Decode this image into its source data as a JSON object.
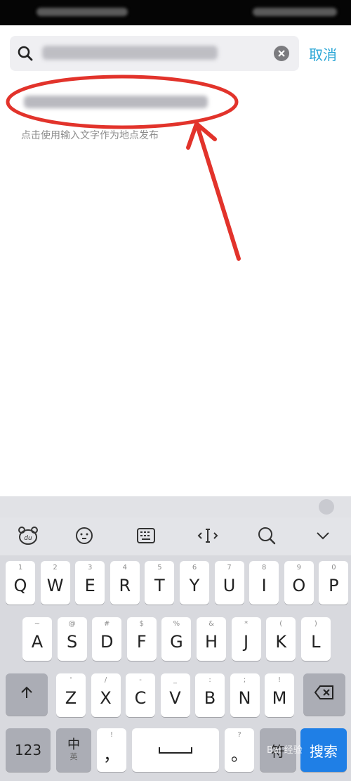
{
  "search": {
    "cancel_label": "取消"
  },
  "hint": "点击使用输入文字作为地点发布",
  "keyboard": {
    "row1": [
      {
        "main": "Q",
        "sym": "1"
      },
      {
        "main": "W",
        "sym": "2"
      },
      {
        "main": "E",
        "sym": "3"
      },
      {
        "main": "R",
        "sym": "4"
      },
      {
        "main": "T",
        "sym": "5"
      },
      {
        "main": "Y",
        "sym": "6"
      },
      {
        "main": "U",
        "sym": "7"
      },
      {
        "main": "I",
        "sym": "8"
      },
      {
        "main": "O",
        "sym": "9"
      },
      {
        "main": "P",
        "sym": "0"
      }
    ],
    "row2": [
      {
        "main": "A",
        "sym": "~"
      },
      {
        "main": "S",
        "sym": "@"
      },
      {
        "main": "D",
        "sym": "#"
      },
      {
        "main": "F",
        "sym": "$"
      },
      {
        "main": "G",
        "sym": "%"
      },
      {
        "main": "H",
        "sym": "&"
      },
      {
        "main": "J",
        "sym": "*"
      },
      {
        "main": "K",
        "sym": "("
      },
      {
        "main": "L",
        "sym": ")"
      }
    ],
    "row3": [
      {
        "main": "Z",
        "sym": "'"
      },
      {
        "main": "X",
        "sym": "/"
      },
      {
        "main": "C",
        "sym": "-"
      },
      {
        "main": "V",
        "sym": "_"
      },
      {
        "main": "B",
        "sym": ":"
      },
      {
        "main": "N",
        "sym": ";"
      },
      {
        "main": "M",
        "sym": "!"
      }
    ],
    "num_label": "123",
    "lang_main": "中",
    "lang_sub": "英",
    "comma_label": "，",
    "comma_sym": "!",
    "period_label": "。",
    "period_sym": "?",
    "fu_label": "符",
    "search_label": "搜索"
  },
  "colors": {
    "accent": "#2aa6d6",
    "annotation": "#e2332b",
    "search_key": "#1f7fe6"
  },
  "icons": {
    "search": "search-icon",
    "clear": "clear-icon",
    "toolbar": [
      "du-logo-icon",
      "emoji-icon",
      "keyboard-icon",
      "cursor-icon",
      "search-icon",
      "chevron-down-icon"
    ],
    "shift": "shift-icon",
    "backspace": "backspace-icon",
    "space": "space-icon"
  },
  "watermark": "Bai 经验"
}
